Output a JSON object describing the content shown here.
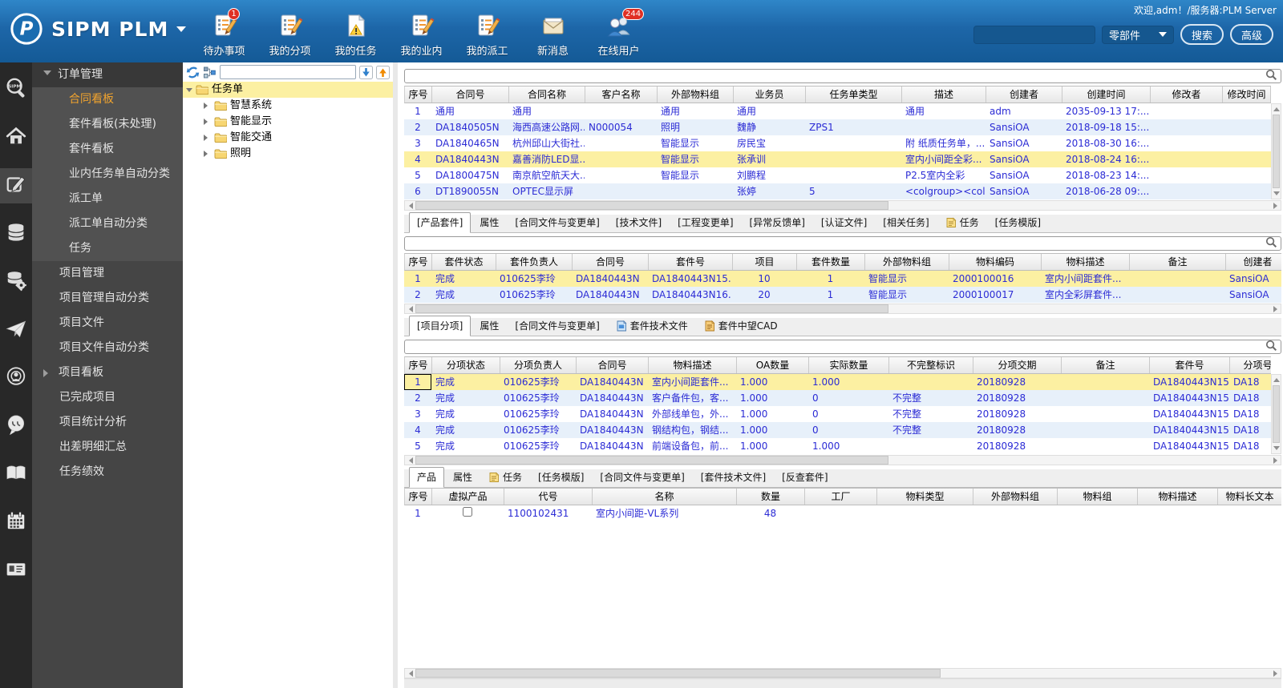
{
  "colors": {
    "header_blue": "#1d66a8",
    "link_text": "#2b2bd5",
    "selected_row": "#fcf0a2",
    "alt_row": "#e7f0fa",
    "active_menu_item": "#f0a32e"
  },
  "header": {
    "logo_text": "SIPM PLM",
    "welcome": "欢迎,adm！/服务器:PLM Server",
    "toolbar": [
      {
        "name": "todo-items",
        "label": "待办事项",
        "icon": "doc-pencil",
        "badge": "1"
      },
      {
        "name": "my-subitems",
        "label": "我的分项",
        "icon": "doc-pencil"
      },
      {
        "name": "my-tasks",
        "label": "我的任务",
        "icon": "doc-warning"
      },
      {
        "name": "my-internal",
        "label": "我的业内",
        "icon": "doc-pencil"
      },
      {
        "name": "my-dispatch",
        "label": "我的派工",
        "icon": "doc-pencil"
      },
      {
        "name": "new-messages",
        "label": "新消息",
        "icon": "envelope"
      },
      {
        "name": "online-users",
        "label": "在线用户",
        "icon": "users",
        "badge": "244"
      }
    ],
    "search": {
      "value": "",
      "category": "零部件",
      "search_button": "搜索",
      "advanced_button": "高级"
    }
  },
  "sidebar": {
    "rail_icons": [
      "sipm-search",
      "home",
      "edit",
      "database",
      "database-gear",
      "paper-plane",
      "radar",
      "chat",
      "book",
      "calendar",
      "id-card"
    ],
    "active_rail_index": 2,
    "menu": [
      {
        "label": "订单管理",
        "type": "group-expanded"
      },
      {
        "label": "合同看板",
        "type": "sub",
        "active": true
      },
      {
        "label": "套件看板(未处理)",
        "type": "sub"
      },
      {
        "label": "套件看板",
        "type": "sub"
      },
      {
        "label": "业内任务单自动分类",
        "type": "sub"
      },
      {
        "label": "派工单",
        "type": "sub"
      },
      {
        "label": "派工单自动分类",
        "type": "sub"
      },
      {
        "label": "任务",
        "type": "sub"
      },
      {
        "label": "项目管理",
        "type": "item"
      },
      {
        "label": "项目管理自动分类",
        "type": "item"
      },
      {
        "label": "项目文件",
        "type": "item"
      },
      {
        "label": "项目文件自动分类",
        "type": "item"
      },
      {
        "label": "项目看板",
        "type": "group-collapsed"
      },
      {
        "label": "已完成项目",
        "type": "item"
      },
      {
        "label": "项目统计分析",
        "type": "item"
      },
      {
        "label": "出差明细汇总",
        "type": "item"
      },
      {
        "label": "任务绩效",
        "type": "item"
      }
    ]
  },
  "tree": {
    "root": "任务单",
    "children": [
      "智慧系统",
      "智能显示",
      "智能交通",
      "照明"
    ]
  },
  "sections": {
    "contracts": {
      "columns": [
        "序号",
        "合同号",
        "合同名称",
        "客户名称",
        "外部物料组",
        "业务员",
        "任务单类型",
        "描述",
        "创建者",
        "创建时间",
        "修改者",
        "修改时间"
      ],
      "rows": [
        [
          "1",
          "通用",
          "通用",
          "",
          "通用",
          "通用",
          "",
          "通用",
          "adm",
          "2035-09-13 17:...",
          "",
          ""
        ],
        [
          "2",
          "DA1840505N",
          "海西高速公路网...",
          "N000054",
          "照明",
          "魏静",
          "ZPS1",
          "",
          "SansiOA",
          "2018-09-18 15:...",
          "",
          ""
        ],
        [
          "3",
          "DA1840465N",
          "杭州邱山大街社...",
          "",
          "智能显示",
          "房民宝",
          "",
          "附 纸质任务单，...",
          "SansiOA",
          "2018-08-30 16:...",
          "",
          ""
        ],
        [
          "4",
          "DA1840443N",
          "嘉善消防LED显...",
          "",
          "智能显示",
          "张承训",
          "",
          "室内小间距全彩...",
          "SansiOA",
          "2018-08-24 16:...",
          "",
          ""
        ],
        [
          "5",
          "DA1800475N",
          "南京航空航天大...",
          "",
          "智能显示",
          "刘鹏程",
          "",
          "P2.5室内全彩",
          "SansiOA",
          "2018-08-23 14:...",
          "",
          ""
        ],
        [
          "6",
          "DT1890055N",
          "OPTEC显示屏",
          "",
          "",
          "张婷",
          "5",
          "<colgroup><col ...",
          "SansiOA",
          "2018-06-28 09:...",
          "",
          ""
        ]
      ],
      "selected_row": 4
    },
    "kits": {
      "tabs": [
        {
          "label": "[产品套件]",
          "active": true
        },
        {
          "label": "属性"
        },
        {
          "label": "[合同文件与变更单]"
        },
        {
          "label": "[技术文件]"
        },
        {
          "label": "[工程变更单]"
        },
        {
          "label": "[异常反馈单]"
        },
        {
          "label": "[认证文件]"
        },
        {
          "label": "[相关任务]"
        },
        {
          "label": "任务",
          "icon": "yellow-doc"
        },
        {
          "label": "[任务模版]"
        }
      ],
      "columns": [
        "序号",
        "套件状态",
        "套件负责人",
        "合同号",
        "套件号",
        "项目",
        "套件数量",
        "外部物料组",
        "物料编码",
        "物料描述",
        "备注",
        "创建者"
      ],
      "rows": [
        [
          "1",
          "完成",
          "010625李玲",
          "DA1840443N",
          "DA1840443N15...",
          "10",
          "1",
          "智能显示",
          "2000100016",
          "室内小间距套件...",
          "",
          "SansiOA"
        ],
        [
          "2",
          "完成",
          "010625李玲",
          "DA1840443N",
          "DA1840443N16...",
          "20",
          "1",
          "智能显示",
          "2000100017",
          "室内全彩屏套件...",
          "",
          "SansiOA"
        ]
      ],
      "selected_row": 1
    },
    "subitems": {
      "tabs": [
        {
          "label": "[项目分项]",
          "active": true
        },
        {
          "label": "属性"
        },
        {
          "label": "[合同文件与变更单]"
        },
        {
          "label": "套件技术文件",
          "icon": "blue-doc"
        },
        {
          "label": "套件中望CAD",
          "icon": "orange-doc"
        }
      ],
      "columns": [
        "序号",
        "分项状态",
        "分项负责人",
        "合同号",
        "物料描述",
        "OA数量",
        "实际数量",
        "不完整标识",
        "分项交期",
        "备注",
        "套件号",
        "分项号"
      ],
      "rows": [
        [
          "1",
          "完成",
          "010625李玲",
          "DA1840443N",
          "室内小间距套件...",
          "1.000",
          "1.000",
          "",
          "20180928",
          "",
          "DA1840443N15...",
          "DA18"
        ],
        [
          "2",
          "完成",
          "010625李玲",
          "DA1840443N",
          "客户备件包，客...",
          "1.000",
          "0",
          "不完整",
          "20180928",
          "",
          "DA1840443N15...",
          "DA18"
        ],
        [
          "3",
          "完成",
          "010625李玲",
          "DA1840443N",
          "外部线单包，外...",
          "1.000",
          "0",
          "不完整",
          "20180928",
          "",
          "DA1840443N15...",
          "DA18"
        ],
        [
          "4",
          "完成",
          "010625李玲",
          "DA1840443N",
          "钢结构包，钢结...",
          "1.000",
          "0",
          "不完整",
          "20180928",
          "",
          "DA1840443N15...",
          "DA18"
        ],
        [
          "5",
          "完成",
          "010625李玲",
          "DA1840443N",
          "前端设备包，前...",
          "1.000",
          "1.000",
          "",
          "20180928",
          "",
          "DA1840443N15...",
          "DA18"
        ]
      ],
      "selected_row": 1,
      "focus_cell": [
        0,
        0
      ]
    },
    "products": {
      "tabs": [
        {
          "label": "产品",
          "active": true
        },
        {
          "label": "属性"
        },
        {
          "label": "任务",
          "icon": "yellow-doc"
        },
        {
          "label": "[任务模版]"
        },
        {
          "label": "[合同文件与变更单]"
        },
        {
          "label": "[套件技术文件]"
        },
        {
          "label": "[反查套件]"
        }
      ],
      "columns": [
        "序号",
        "虚拟产品",
        "代号",
        "名称",
        "数量",
        "工厂",
        "物料类型",
        "外部物料组",
        "物料组",
        "物料描述",
        "物料长文本"
      ],
      "rows": [
        [
          "1",
          "[checkbox]",
          "1100102431",
          "室内小间距-VL系列",
          "48",
          "",
          "",
          "",
          "",
          "",
          ""
        ]
      ]
    }
  }
}
